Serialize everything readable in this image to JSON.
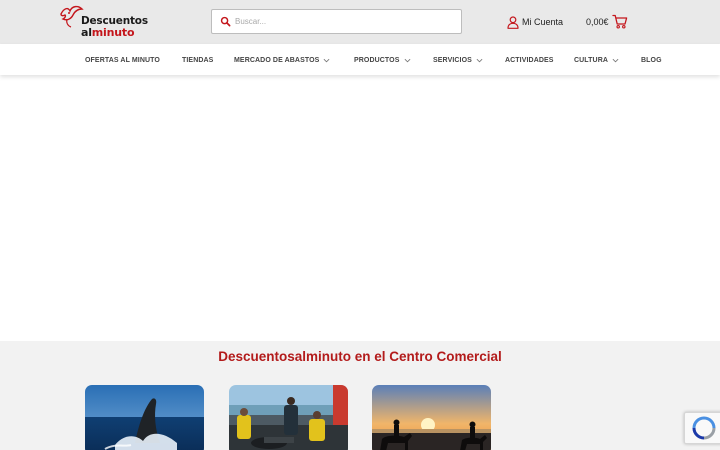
{
  "header": {
    "logo": {
      "line1": "Descuentos",
      "line2_a": "al",
      "line2_b": "minuto"
    },
    "search": {
      "placeholder": "Buscar..."
    },
    "account_label": "Mi Cuenta",
    "cart_total": "0,00€"
  },
  "nav": {
    "items": [
      {
        "label": "OFERTAS AL MINUTO",
        "dropdown": false
      },
      {
        "label": "TIENDAS",
        "dropdown": false
      },
      {
        "label": "MERCADO DE ABASTOS",
        "dropdown": true
      },
      {
        "label": "PRODUCTOS",
        "dropdown": true
      },
      {
        "label": "SERVICIOS",
        "dropdown": true
      },
      {
        "label": "ACTIVIDADES",
        "dropdown": false
      },
      {
        "label": "CULTURA",
        "dropdown": true
      },
      {
        "label": "BLOG",
        "dropdown": false
      }
    ]
  },
  "section": {
    "title": "Descuentosalminuto en el Centro Comercial",
    "cards": [
      {
        "image": "whale-breaching-photo"
      },
      {
        "image": "fishermen-on-boat-photo"
      },
      {
        "image": "horse-riders-sunset-beach-photo"
      }
    ]
  },
  "colors": {
    "brand_red": "#c4161c",
    "title_red": "#b31b1b",
    "topbar_bg": "#e9e9e9",
    "section_bg": "#f2f2f2"
  },
  "icons": [
    "bird-logo-icon",
    "search-icon",
    "user-icon",
    "cart-icon",
    "chevron-down-icon",
    "recaptcha-icon"
  ]
}
